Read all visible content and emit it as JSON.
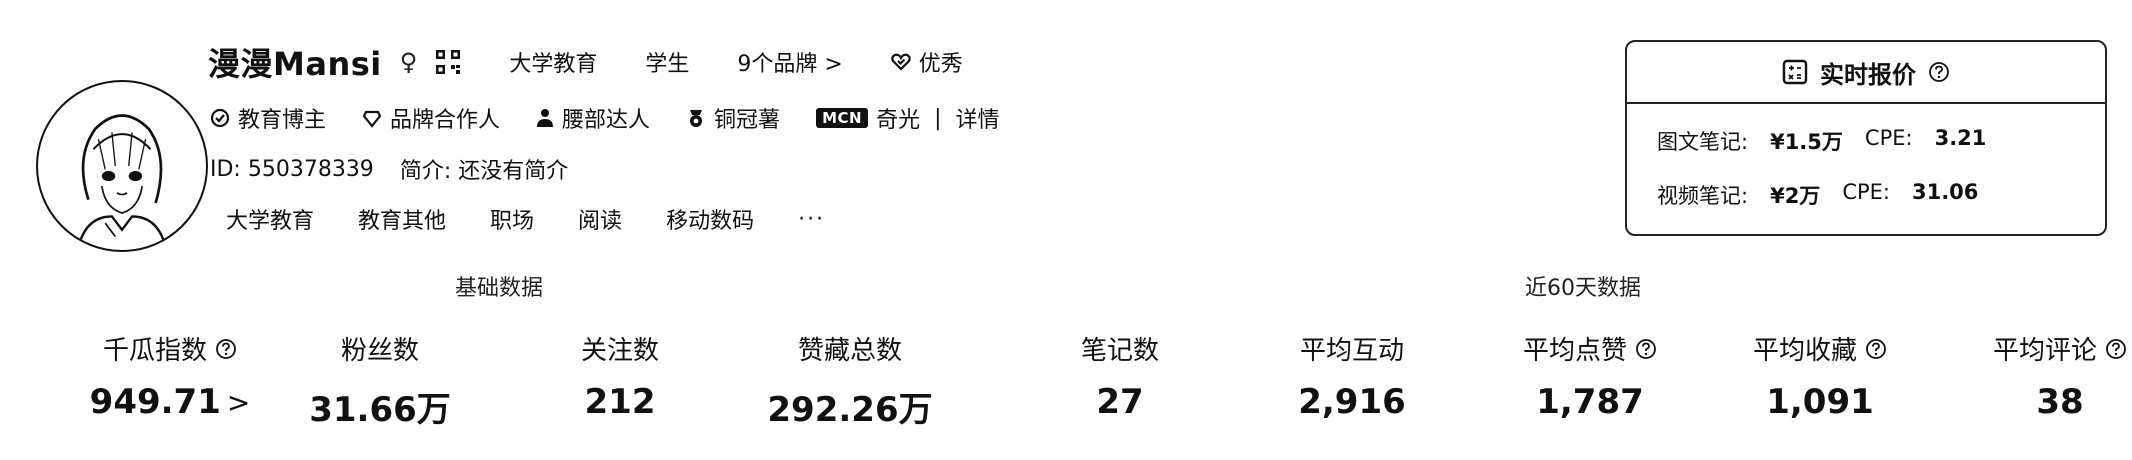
{
  "profile": {
    "name": "漫漫Mansi",
    "gender": "♀",
    "tags": [
      "大学教育",
      "学生",
      "9个品牌 >"
    ],
    "quality_label": "优秀",
    "badges": [
      {
        "icon": "check-circle-icon",
        "label": "教育博主"
      },
      {
        "icon": "diamond-icon",
        "label": "品牌合作人"
      },
      {
        "icon": "person-icon",
        "label": "腰部达人"
      },
      {
        "icon": "medal-icon",
        "label": "铜冠薯"
      }
    ],
    "mcn": {
      "badge": "MCN",
      "name": "奇光",
      "sep": "|",
      "detail": "详情"
    },
    "id_text": "ID: 550378339",
    "bio_text": "简介: 还没有简介",
    "categories": [
      "大学教育",
      "教育其他",
      "职场",
      "阅读",
      "移动数码"
    ],
    "more": "···"
  },
  "pricing": {
    "title": "实时报价",
    "rows": [
      {
        "label": "图文笔记:",
        "price": "¥1.5万",
        "cpe_label": "CPE:",
        "cpe": "3.21"
      },
      {
        "label": "视频笔记:",
        "price": "¥2万",
        "cpe_label": "CPE:",
        "cpe": "31.06"
      }
    ]
  },
  "sections": {
    "basic": "基础数据",
    "recent": "近60天数据"
  },
  "metrics": [
    {
      "label": "千瓜指数",
      "value": "949.71",
      "help": true,
      "arrow": ">"
    },
    {
      "label": "粉丝数",
      "value": "31.66万"
    },
    {
      "label": "关注数",
      "value": "212"
    },
    {
      "label": "赞藏总数",
      "value": "292.26万"
    },
    {
      "label": "笔记数",
      "value": "27"
    },
    {
      "label": "平均互动",
      "value": "2,916"
    },
    {
      "label": "平均点赞",
      "value": "1,787",
      "help": true
    },
    {
      "label": "平均收藏",
      "value": "1,091",
      "help": true
    },
    {
      "label": "平均评论",
      "value": "38",
      "help": true
    }
  ]
}
